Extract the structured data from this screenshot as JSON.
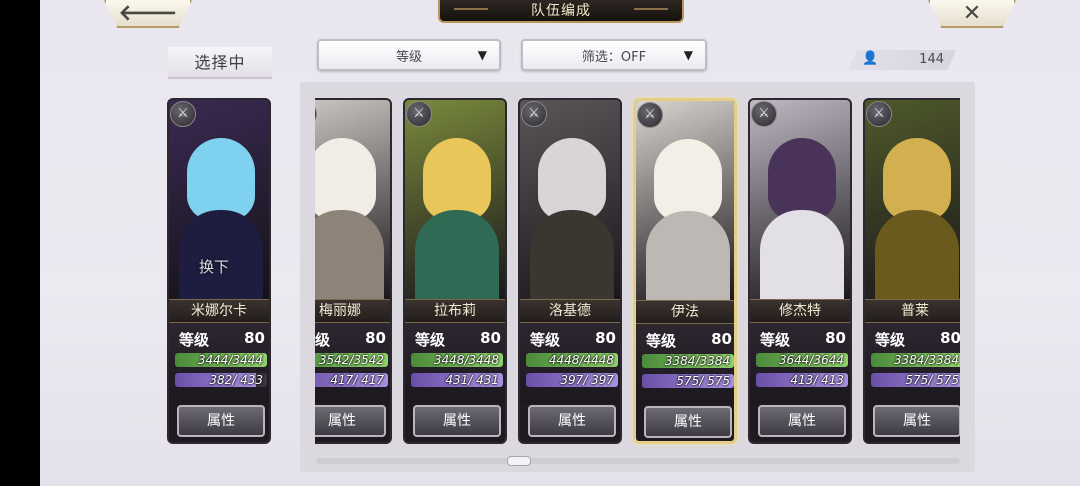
{
  "header": {
    "title": "队伍编成"
  },
  "nav": {
    "back_icon": "🡐",
    "close_icon": "✕"
  },
  "selecting_label": "选择中",
  "sort_dropdown": {
    "value": "等级"
  },
  "filter_dropdown": {
    "value": "筛选：OFF"
  },
  "unit_count": "144",
  "labels": {
    "level": "等级",
    "attr": "属性"
  },
  "selected": {
    "name": "米娜尔卡",
    "level": "80",
    "hp": "3444/3444",
    "mp": "382/ 433",
    "mp_fill": 0.88,
    "swap": "换下",
    "colors": {
      "bg": "#3a2a52",
      "hair": "#7fd2ef",
      "body": "#1e1d40"
    }
  },
  "roster": [
    {
      "name": "梅丽娜",
      "level": "80",
      "hp": "3542/3542",
      "mp": "417/ 417",
      "mp_fill": 1.0,
      "colors": {
        "bg": "#cfc9c4",
        "hair": "#f1ede6",
        "body": "#8d8378"
      }
    },
    {
      "name": "拉布莉",
      "level": "80",
      "hp": "3448/3448",
      "mp": "431/ 431",
      "mp_fill": 1.0,
      "colors": {
        "bg": "#7a8a3c",
        "hair": "#e9c65a",
        "body": "#2e6a54"
      }
    },
    {
      "name": "洛基德",
      "level": "80",
      "hp": "4448/4448",
      "mp": "397/ 397",
      "mp_fill": 1.0,
      "colors": {
        "bg": "#5a5658",
        "hair": "#d8d4d8",
        "body": "#3a3630"
      }
    },
    {
      "name": "伊法",
      "level": "80",
      "hp": "3384/3384",
      "mp": "575/ 575",
      "mp_fill": 1.0,
      "colors": {
        "bg": "#d8d4cf",
        "hair": "#f3efe6",
        "body": "#bdb8b4"
      }
    },
    {
      "name": "修杰特",
      "level": "80",
      "hp": "3644/3644",
      "mp": "413/ 413",
      "mp_fill": 1.0,
      "colors": {
        "bg": "#bfb9c4",
        "hair": "#4a3358",
        "body": "#e2dfe6"
      }
    },
    {
      "name": "普莱",
      "level": "80",
      "hp": "3384/3384",
      "mp": "575/ 575",
      "mp_fill": 1.0,
      "colors": {
        "bg": "#4f5a2a",
        "hair": "#d2b050",
        "body": "#6a5a1e"
      }
    }
  ]
}
